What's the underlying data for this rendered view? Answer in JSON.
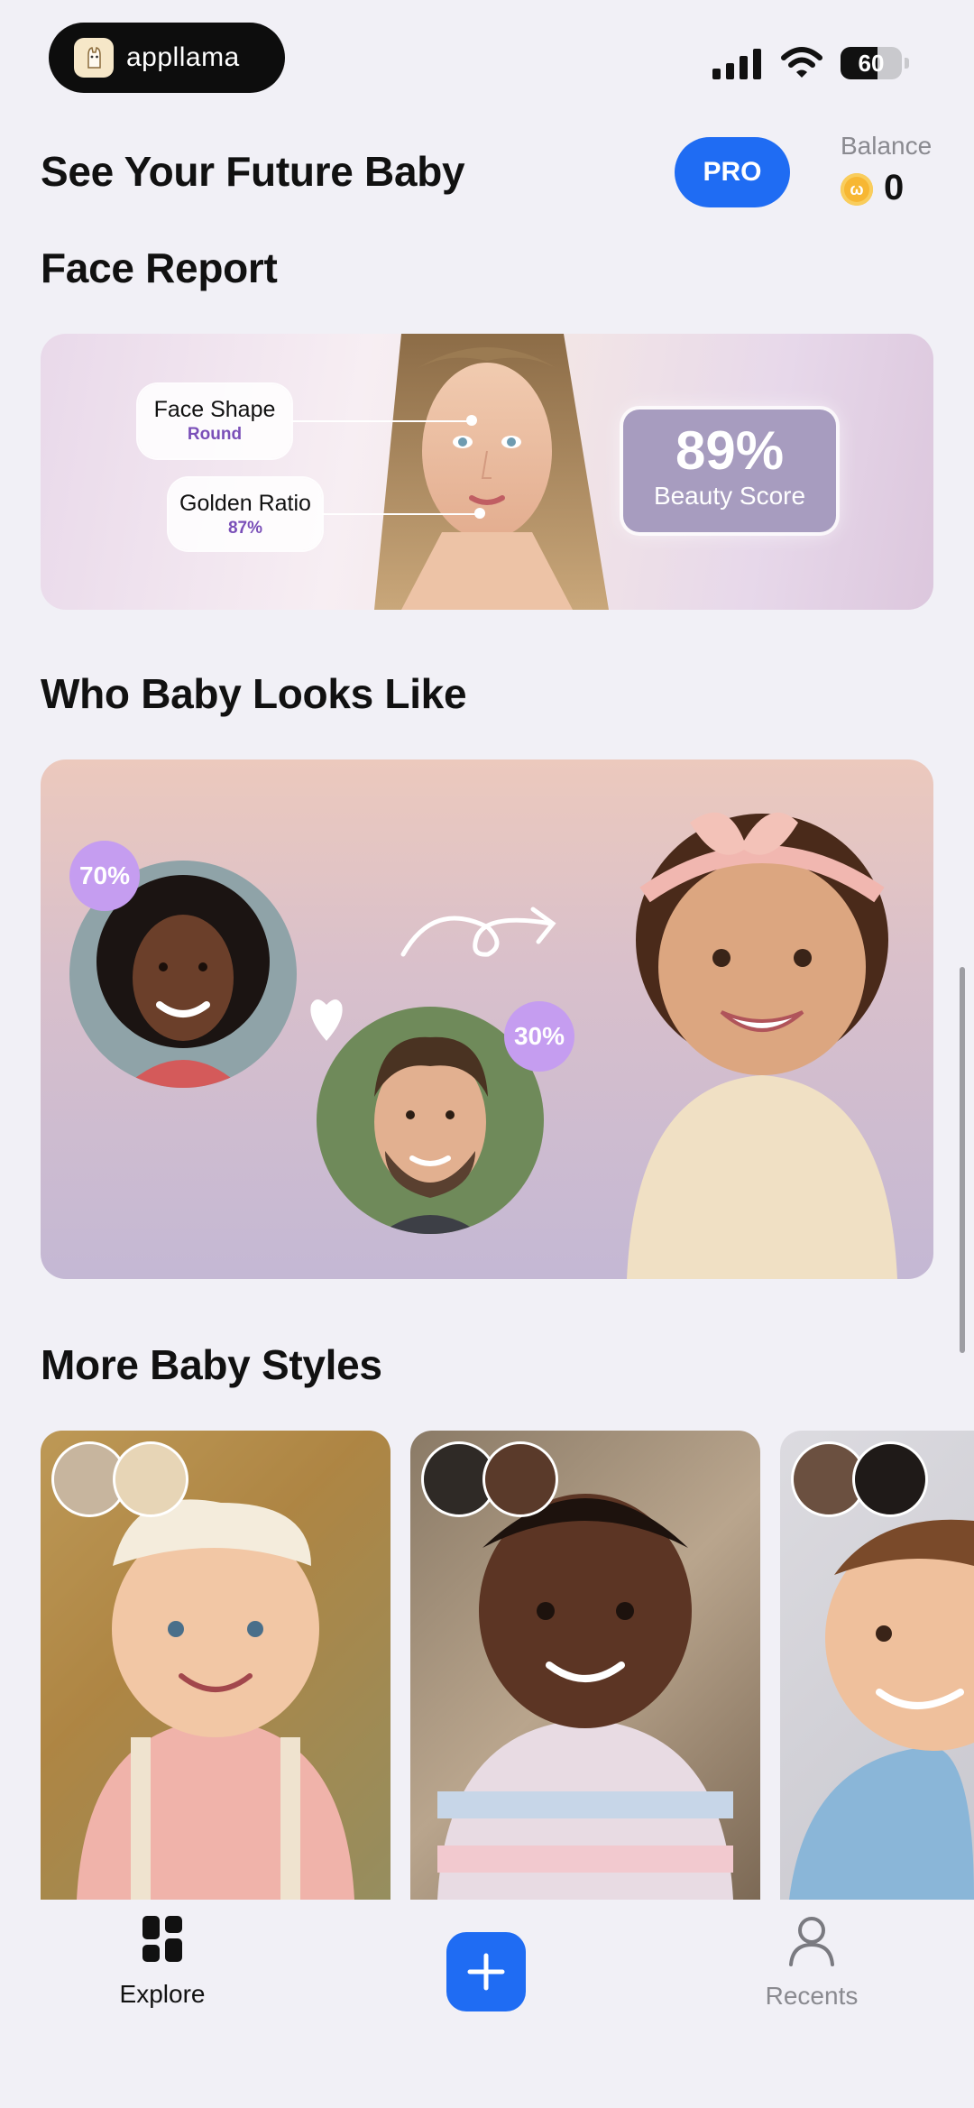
{
  "status_bar": {
    "app_name": "appllama",
    "battery": "60",
    "battery_level": 0.6
  },
  "header": {
    "title": "See Your Future Baby",
    "pro_label": "PRO",
    "balance_label": "Balance",
    "balance_value": "0"
  },
  "face_report": {
    "title": "Face Report",
    "tags": [
      {
        "label": "Face Shape",
        "value": "Round"
      },
      {
        "label": "Golden Ratio",
        "value": "87%"
      }
    ],
    "score": {
      "value": "89%",
      "label": "Beauty Score"
    }
  },
  "who_baby": {
    "title": "Who Baby Looks Like",
    "parent1_pct": "70%",
    "parent2_pct": "30%"
  },
  "more_styles": {
    "title": "More Baby Styles"
  },
  "nav": {
    "explore": "Explore",
    "recents": "Recents"
  },
  "colors": {
    "accent": "#1f6cf3",
    "badge": "#c59df0",
    "background": "#f1f0f6"
  }
}
